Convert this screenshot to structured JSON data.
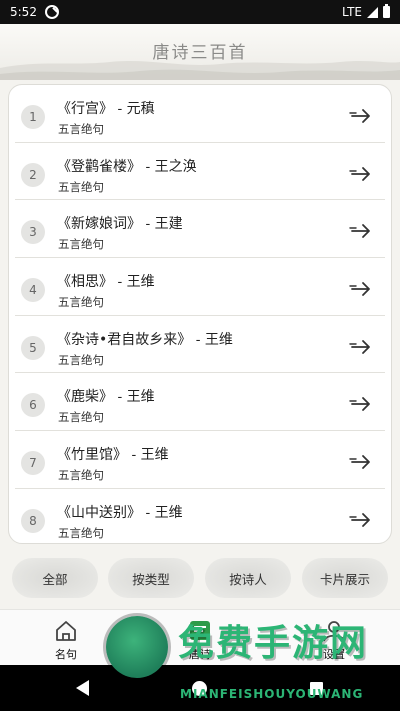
{
  "status_bar": {
    "time": "5:52",
    "network": "LTE"
  },
  "header": {
    "title": "唐诗三百首"
  },
  "poems": [
    {
      "number": "1",
      "title": "《行宫》 - 元稹",
      "type": "五言绝句"
    },
    {
      "number": "2",
      "title": "《登鹳雀楼》 - 王之涣",
      "type": "五言绝句"
    },
    {
      "number": "3",
      "title": "《新嫁娘词》 - 王建",
      "type": "五言绝句"
    },
    {
      "number": "4",
      "title": "《相思》 - 王维",
      "type": "五言绝句"
    },
    {
      "number": "5",
      "title": "《杂诗•君自故乡来》 - 王维",
      "type": "五言绝句"
    },
    {
      "number": "6",
      "title": "《鹿柴》 - 王维",
      "type": "五言绝句"
    },
    {
      "number": "7",
      "title": "《竹里馆》 - 王维",
      "type": "五言绝句"
    },
    {
      "number": "8",
      "title": "《山中送别》 - 王维",
      "type": "五言绝句"
    }
  ],
  "filters": [
    "全部",
    "按类型",
    "按诗人",
    "卡片展示"
  ],
  "bottom_nav": [
    {
      "label": "名句",
      "icon": "home-icon"
    },
    {
      "label": "唐诗",
      "icon": "list-icon"
    },
    {
      "label": "设置",
      "icon": "user-icon"
    }
  ],
  "watermark": {
    "main": "免费手游网",
    "sub": "MIANFEISHOUYOUWANG"
  },
  "colors": {
    "accent_green": "#2e9b4a",
    "watermark_green": "#2cb575"
  }
}
